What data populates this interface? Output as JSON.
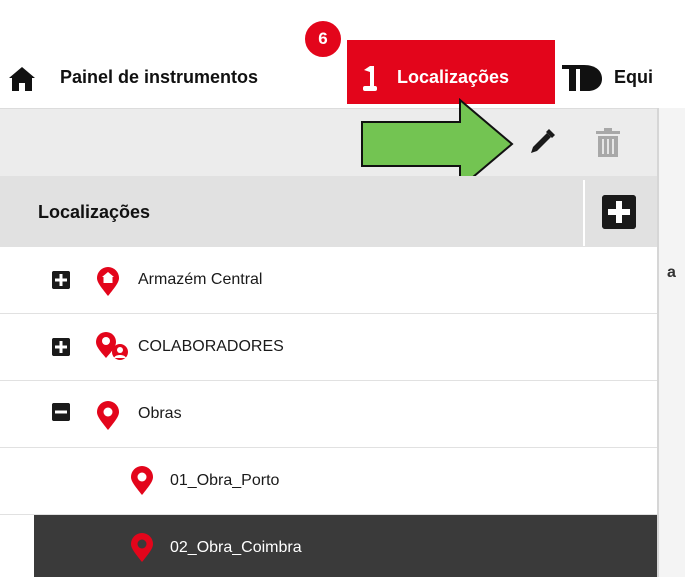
{
  "nav": {
    "items": [
      {
        "label": "Painel de instrumentos",
        "icon": "home-icon"
      },
      {
        "label": "Localizações",
        "icon": "location-pin-icon",
        "active": true,
        "badge": "6"
      },
      {
        "label": "Equi",
        "icon": "equipment-icon"
      }
    ]
  },
  "toolbar": {
    "edit_icon": "pencil-icon",
    "delete_icon": "trash-icon"
  },
  "panel": {
    "title": "Localizações",
    "add_icon": "plus-icon"
  },
  "tree": [
    {
      "label": "Armazém Central",
      "toggle": "expand",
      "icon": "home-pin-icon"
    },
    {
      "label": "COLABORADORES",
      "toggle": "expand",
      "icon": "people-pin-icon"
    },
    {
      "label": "Obras",
      "toggle": "collapse",
      "icon": "location-pin-icon"
    },
    {
      "label": "01_Obra_Porto",
      "toggle": null,
      "icon": "location-pin-icon"
    },
    {
      "label": "02_Obra_Coimbra",
      "toggle": null,
      "icon": "location-pin-icon",
      "selected": true
    }
  ],
  "colors": {
    "brand_red": "#e3051b",
    "arrow_green": "#73c452",
    "selected_row": "#3a3a3a"
  }
}
